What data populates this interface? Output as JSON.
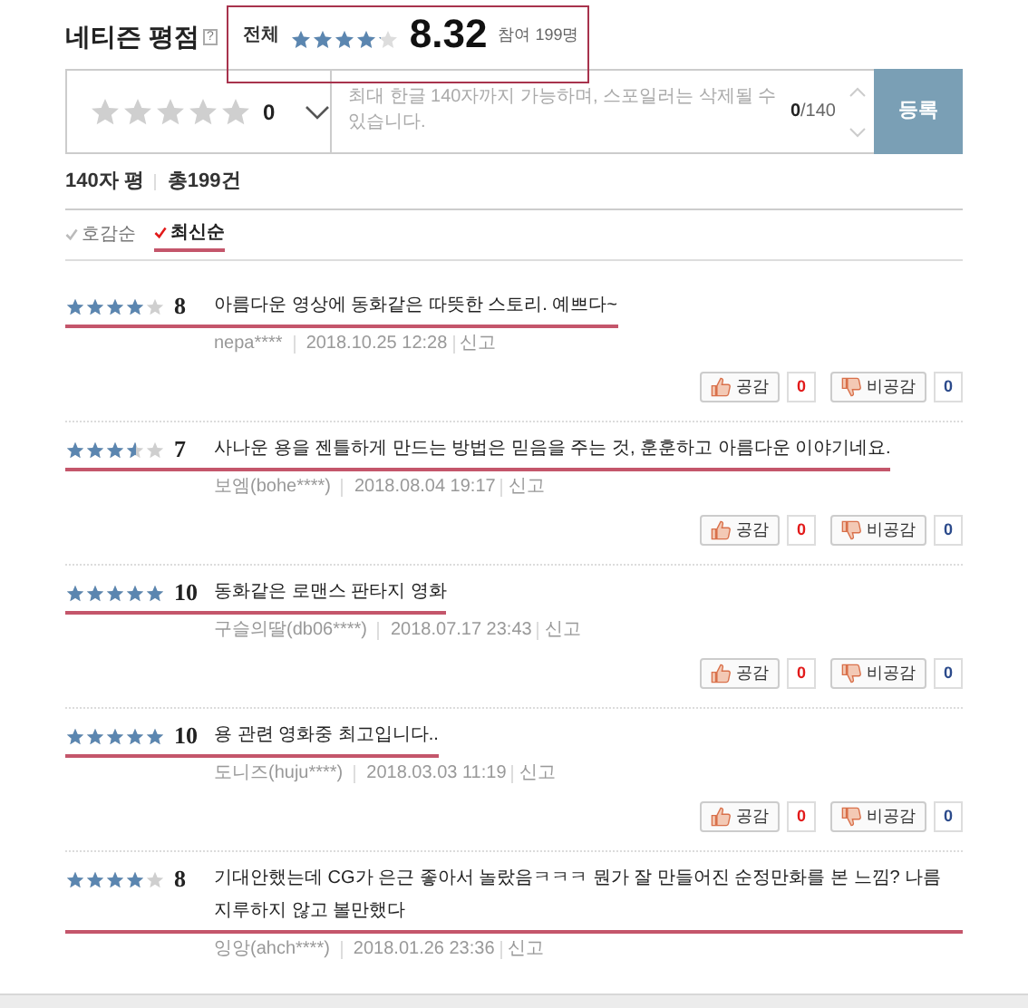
{
  "header": {
    "title": "네티즌 평점",
    "help": "?",
    "overall": {
      "label": "전체",
      "stars": 4.16,
      "score": "8.32",
      "participants": "참여 199명"
    }
  },
  "input": {
    "stars": 0,
    "score": "0",
    "placeholder": "최대 한글 140자까지 가능하며, 스포일러는 삭제될 수 있습니다.",
    "count": "0",
    "max": "/140",
    "submit": "등록"
  },
  "summary": {
    "title": "140자 평",
    "total": "총199건"
  },
  "sort_tabs": [
    {
      "label": "호감순",
      "selected": false
    },
    {
      "label": "최신순",
      "selected": true
    }
  ],
  "reviews": [
    {
      "stars": 4,
      "score": "8",
      "text": "아름다운 영상에 동화같은 따뜻한 스토리. 예쁘다~",
      "author": "nepa****",
      "date": "2018.10.25 12:28",
      "report": "신고",
      "like_label": "공감",
      "likes": "0",
      "dislike_label": "비공감",
      "dislikes": "0"
    },
    {
      "stars": 3.5,
      "score": "7",
      "text": "사나운 용을 젠틀하게 만드는 방법은 믿음을 주는 것, 훈훈하고 아름다운 이야기네요.",
      "author": "보엠(bohe****)",
      "date": "2018.08.04 19:17",
      "report": "신고",
      "like_label": "공감",
      "likes": "0",
      "dislike_label": "비공감",
      "dislikes": "0"
    },
    {
      "stars": 5,
      "score": "10",
      "text": "동화같은 로맨스 판타지 영화",
      "author": "구슬의딸(db06****)",
      "date": "2018.07.17 23:43",
      "report": "신고",
      "like_label": "공감",
      "likes": "0",
      "dislike_label": "비공감",
      "dislikes": "0"
    },
    {
      "stars": 5,
      "score": "10",
      "text": "용 관련 영화중 최고입니다..",
      "author": "도니즈(huju****)",
      "date": "2018.03.03 11:19",
      "report": "신고",
      "like_label": "공감",
      "likes": "0",
      "dislike_label": "비공감",
      "dislikes": "0"
    },
    {
      "stars": 4,
      "score": "8",
      "text": "기대안했는데 CG가 은근 좋아서 놀랐음ㅋㅋㅋ 뭔가 잘 만들어진 순정만화를 본 느낌? 나름 지루하지 않고 볼만했다",
      "author": "잉앙(ahch****)",
      "date": "2018.01.26 23:36",
      "report": "신고"
    }
  ]
}
